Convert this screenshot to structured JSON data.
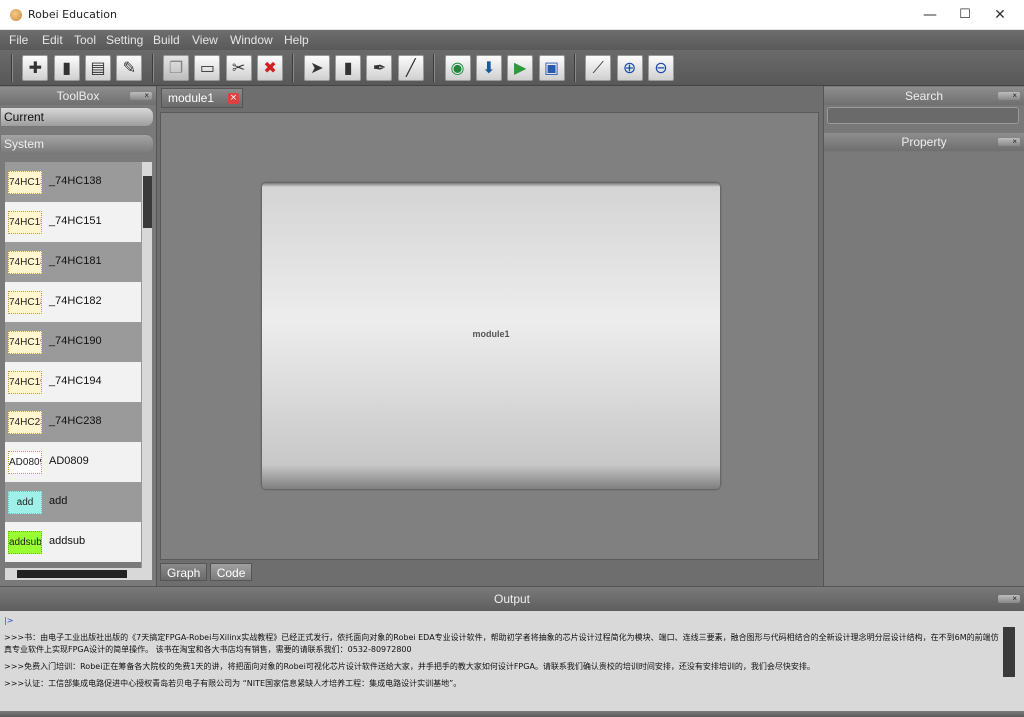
{
  "window": {
    "title": "Robei  Education",
    "min_glyph": "—",
    "max_glyph": "☐",
    "close_glyph": "✕"
  },
  "menu": [
    "File",
    "Edit",
    "Tool",
    "Setting",
    "Build",
    "View",
    "Window",
    "Help"
  ],
  "toolbox": {
    "title": "ToolBox",
    "close_glyph": "×",
    "categories": [
      "Current",
      "System"
    ],
    "components": [
      {
        "thumb": "74HC138",
        "name": "_74HC138"
      },
      {
        "thumb": "74HC151",
        "name": "_74HC151"
      },
      {
        "thumb": "74HC181",
        "name": "_74HC181"
      },
      {
        "thumb": "74HC182",
        "name": "_74HC182"
      },
      {
        "thumb": "74HC190",
        "name": "_74HC190"
      },
      {
        "thumb": "74HC194",
        "name": "_74HC194"
      },
      {
        "thumb": "74HC238",
        "name": "_74HC238"
      },
      {
        "thumb": "AD0809",
        "name": "AD0809"
      },
      {
        "thumb": "add",
        "name": "add"
      },
      {
        "thumb": "addsub",
        "name": "addsub"
      }
    ]
  },
  "editor": {
    "tab_label": "module1",
    "tab_close_glyph": "×",
    "module_label": "module1",
    "bottom_tabs": [
      "Graph",
      "Code"
    ]
  },
  "search": {
    "title": "Search",
    "close_glyph": "×",
    "value": ""
  },
  "property": {
    "title": "Property",
    "close_glyph": "×"
  },
  "output": {
    "title": "Output",
    "close_glyph": "×",
    "prompt": "|>",
    "lines": [
      ">>>书：由电子工业出版社出版的《7天搞定FPGA-Robei与Xilinx实战教程》已经正式发行，依托面向对象的Robei EDA专业设计软件，帮助初学者将抽象的芯片设计过程简化为模块、端口、连线三要素，融合图形与代码相结合的全新设计理念明分层设计结构，在不到6M的前端仿真专业软件上实现FPGA设计的简单操作。 该书在淘宝和各大书店均有销售，需要的请联系我们：0532-80972800",
      ">>>免费入门培训：Robei正在筹备各大院校的免费1天的讲，将把面向对象的Robei可视化芯片设计软件送给大家，并手把手的教大家如何设计FPGA。请联系我们确认贵校的培训时间安排，还没有安排培训的，我们会尽快安排。",
      ">>>认证：工信部集成电路促进中心授权青岛若贝电子有限公司为 “NITE国家信息紧缺人才培养工程：集成电路设计实训基地”。"
    ]
  },
  "toolbar_icons": [
    "new-icon",
    "open-icon",
    "save-icon",
    "save-as-icon",
    "copy-icon",
    "paste-icon",
    "cut-icon",
    "delete-icon",
    "pointer-icon",
    "module-icon",
    "pen-icon",
    "wire-icon",
    "run-icon",
    "download-icon",
    "export-icon",
    "zoom-fit-icon",
    "probe-icon",
    "zoom-in-icon",
    "zoom-out-icon"
  ]
}
